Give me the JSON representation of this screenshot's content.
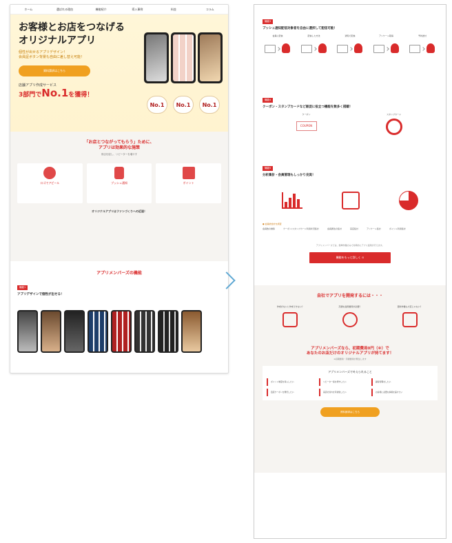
{
  "left": {
    "nav": [
      "ホーム",
      "選ばれる理由",
      "機能紹介",
      "導入事例",
      "料金",
      "コラム"
    ],
    "hero_title": "お客様とお店をつなげる\nオリジナルアプリ",
    "hero_sub": "個性が出せるアプリデザイン！\n会員証ボタン背景も自由に差し替え可能！",
    "hero_btn": "資料請求はこちら",
    "award_label": "店舗アプリ作成サービス",
    "award_prefix": "3部門で",
    "award_main": "No.1",
    "award_suffix": "を獲得！",
    "section_title": "「お店とつながってもらう」ために、\nアプリは効果的な施策",
    "section_sub": "来店を促し、リピーターを増やす",
    "features": [
      {
        "label": "ロゴでアピール"
      },
      {
        "label": "プッシュ通知"
      },
      {
        "label": "ポイント"
      }
    ],
    "bottom_note": "オリジナルアプリはファンづくりへの近道！",
    "funcs_title": "アプリメンバーズの機能",
    "func1_badge": "機能1",
    "func1_title": "アプリデザインで個性が出せる！"
  },
  "right": {
    "f3_badge": "機能3",
    "f3_title": "プッシュ通知配信対象者を自由に選択して配信可能！",
    "flow_steps": [
      "会員に配信",
      "配信した方法",
      "通知で配信",
      "アンケート取得",
      "予約送付"
    ],
    "f4_badge": "機能4",
    "f4_title": "クーポン・スタンプカードなど販促に役立つ機能を数多く搭載！",
    "f4_cols": [
      "クーポン",
      "スタンプカード"
    ],
    "coupon_text": "COUPON",
    "f5_badge": "機能5",
    "f5_title": "分析集計・会員管理もしっかり充実！",
    "check_title": "● 会員総合計を調査",
    "check_items": [
      "会員数の推移",
      "クーポン/スタンプカード利用状況集計",
      "会員属性の集計",
      "来店集計",
      "アンケート集計",
      "ポイント利用集計"
    ],
    "center_note": "アプリメンバーズでは、簡単作業のみで効率的にアプリ運用が行えます。",
    "red_btn": "機能をもっと詳しく ⊙",
    "dev_title": "自社でアプリを開発するには・・・",
    "dev_cols": [
      "作成がないと作成できない？",
      "高額な運用費用が必要？",
      "更新作業も大変じゃない？"
    ],
    "promo_line1": "アプリメンバーズなら、初期費用0円（※）で",
    "promo_line2": "あなたのお店だけのオリジナルアプリが持てます！",
    "promo_sub": "※初期費用・月額費用が発生します",
    "box_title": "アプリメンバーズで叶えられること",
    "box_items": [
      "ポイント制度を導入したい",
      "リピーター客を増やしたい",
      "顧客管理をしたい",
      "自店クーポンを発行したい",
      "来店の流れを可視化したい",
      "お客様に必要な情報を届けたい"
    ],
    "orange_btn": "資料請求はこちら"
  }
}
